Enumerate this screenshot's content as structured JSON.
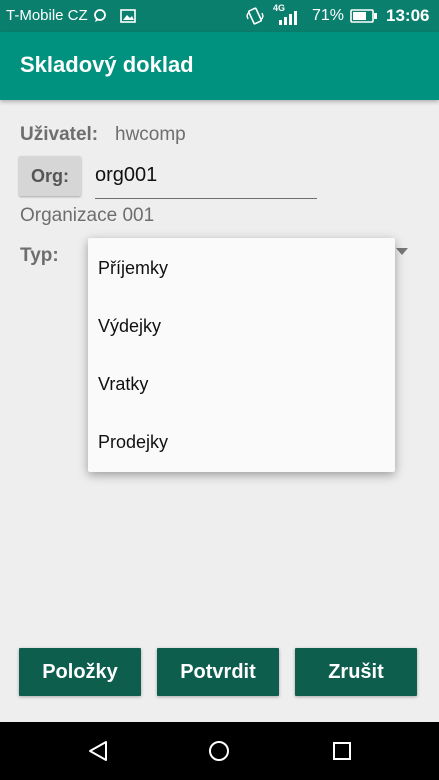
{
  "status_bar": {
    "carrier": "T-Mobile CZ",
    "network": "4G",
    "battery": "71%",
    "time": "13:06"
  },
  "app_bar": {
    "title": "Skladový doklad"
  },
  "form": {
    "user_label": "Uživatel:",
    "user_value": "hwcomp",
    "org_button": "Org:",
    "org_value": "org001",
    "org_name": "Organizace 001",
    "type_label": "Typ:"
  },
  "dropdown": {
    "options": [
      "Příjemky",
      "Výdejky",
      "Vratky",
      "Prodejky"
    ]
  },
  "buttons": {
    "items": "Položky",
    "confirm": "Potvrdit",
    "cancel": "Zrušit"
  },
  "colors": {
    "primary": "#00897B",
    "button": "#0E5E4E",
    "background": "#EEEEEE"
  }
}
